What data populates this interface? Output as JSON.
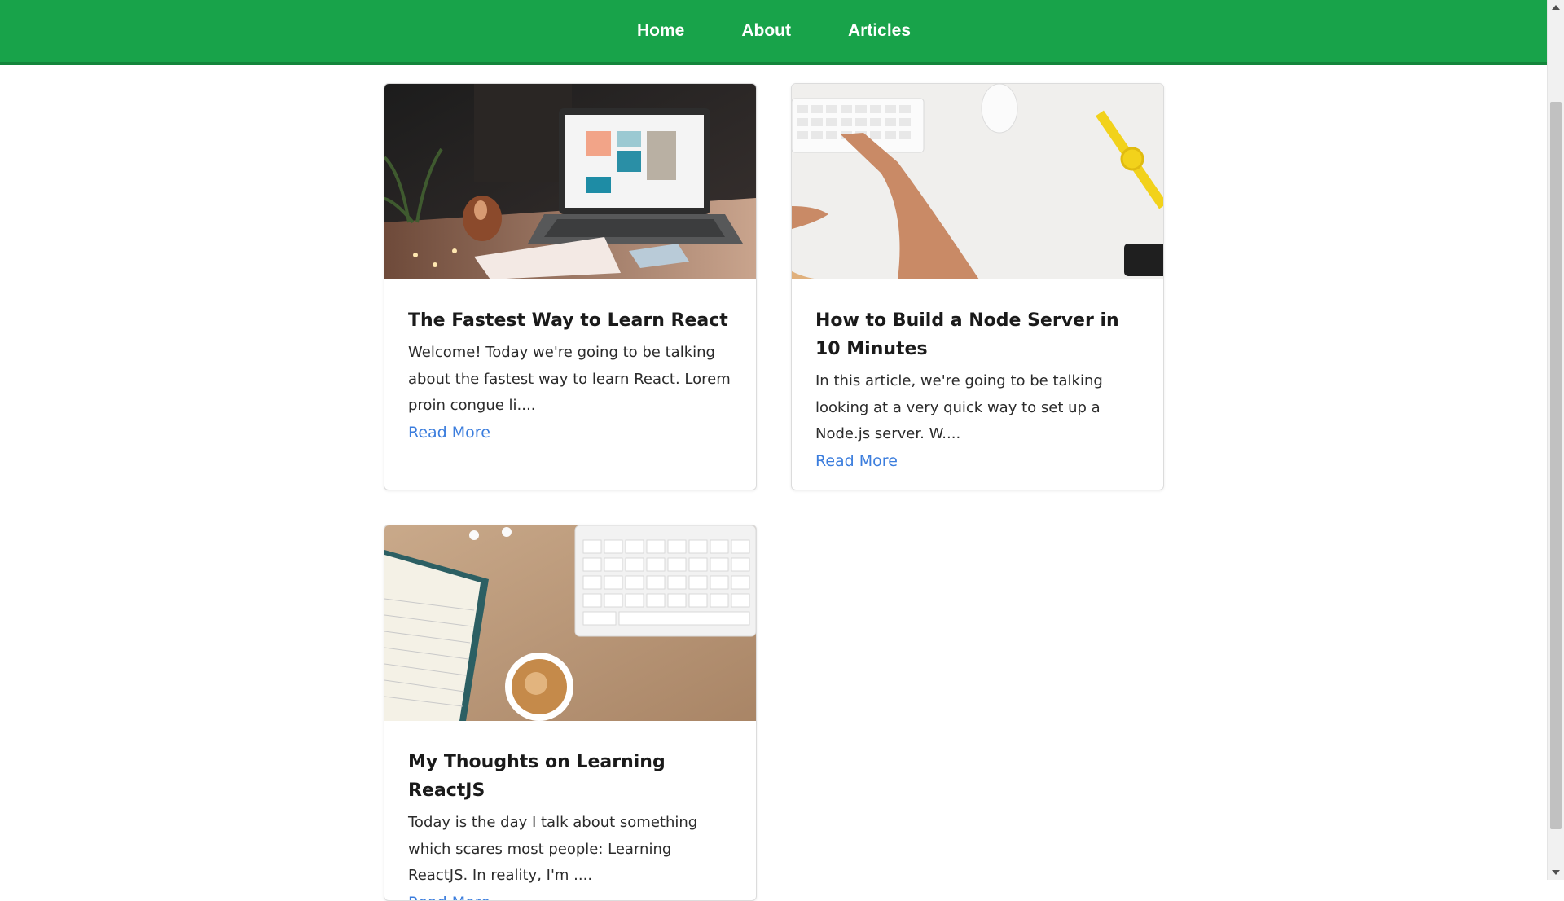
{
  "nav": {
    "items": [
      {
        "label": "Home"
      },
      {
        "label": "About"
      },
      {
        "label": "Articles"
      }
    ]
  },
  "articles": [
    {
      "title": "The Fastest Way to Learn React",
      "excerpt": "Welcome! Today we're going to be talking about the fastest way to learn React. Lorem proin congue li....",
      "link_label": "Read More"
    },
    {
      "title": "How to Build a Node Server in 10 Minutes",
      "excerpt": "In this article, we're going to be talking looking at a very quick way to set up a Node.js server. W....",
      "link_label": "Read More"
    },
    {
      "title": "My Thoughts on Learning ReactJS",
      "excerpt": "Today is the day I talk about something which scares most people: Learning ReactJS. In reality, I'm ....",
      "link_label": "Read More"
    }
  ],
  "colors": {
    "nav_bg": "#18a34a",
    "link": "#3b7ddd"
  }
}
